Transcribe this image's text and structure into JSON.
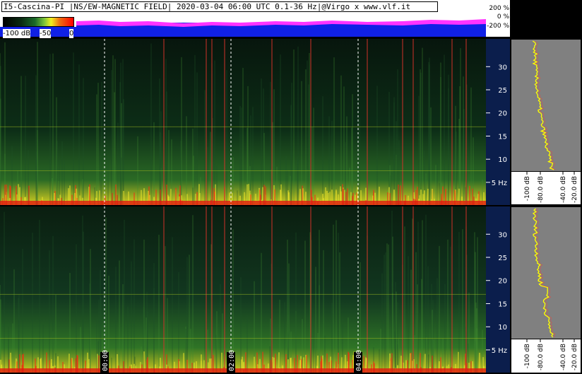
{
  "title": "I5-Cascina-PI |NS/EW-MAGNETIC FIELD| 2020-03-04 06:00 UTC 0.1-36 Hz|@Virgo x www.vlf.it",
  "colorbar": {
    "labels": [
      "-100 dB",
      "-50",
      "0"
    ]
  },
  "colors": {
    "spectrum_line": "#ffff00",
    "hour_marker": "#ffffff",
    "noise_line": "#d8332a",
    "power_bg": "#1020e6",
    "power_trace": "#ff33ff"
  },
  "chart_data": [
    {
      "type": "heatmap",
      "panel": "NS",
      "ylabel": "Hz",
      "y_ticks": [
        5,
        10,
        15,
        20,
        25,
        30
      ],
      "ylim": [
        0.1,
        36
      ],
      "x_ticks": [
        "00:00",
        "02:00",
        "04:00"
      ],
      "colorscale": {
        "min_db": -100,
        "max_db": 0
      }
    },
    {
      "type": "heatmap",
      "panel": "EW",
      "ylabel": "Hz",
      "y_ticks": [
        5,
        10,
        15,
        20,
        25,
        30
      ],
      "ylim": [
        0.1,
        36
      ],
      "x_ticks": [
        "00:00",
        "02:00",
        "04:00"
      ],
      "colorscale": {
        "min_db": -100,
        "max_db": 0
      }
    },
    {
      "type": "line",
      "panel": "NS-spectrum",
      "x_ticks": [
        "-100 dB",
        "-80.0 dB",
        "-40.0 dB",
        "-20.0 dB"
      ],
      "y_ticks": [
        5,
        10,
        15,
        20,
        25,
        30
      ]
    },
    {
      "type": "line",
      "panel": "EW-spectrum",
      "x_ticks": [
        "-100 dB",
        "-80.0 dB",
        "-40.0 dB",
        "-20.0 dB"
      ],
      "y_ticks": [
        5,
        10,
        15,
        20,
        25,
        30
      ]
    },
    {
      "type": "area",
      "panel": "power-strip",
      "y_ticks": [
        "200 %",
        "0 %",
        "-200 %"
      ]
    }
  ]
}
